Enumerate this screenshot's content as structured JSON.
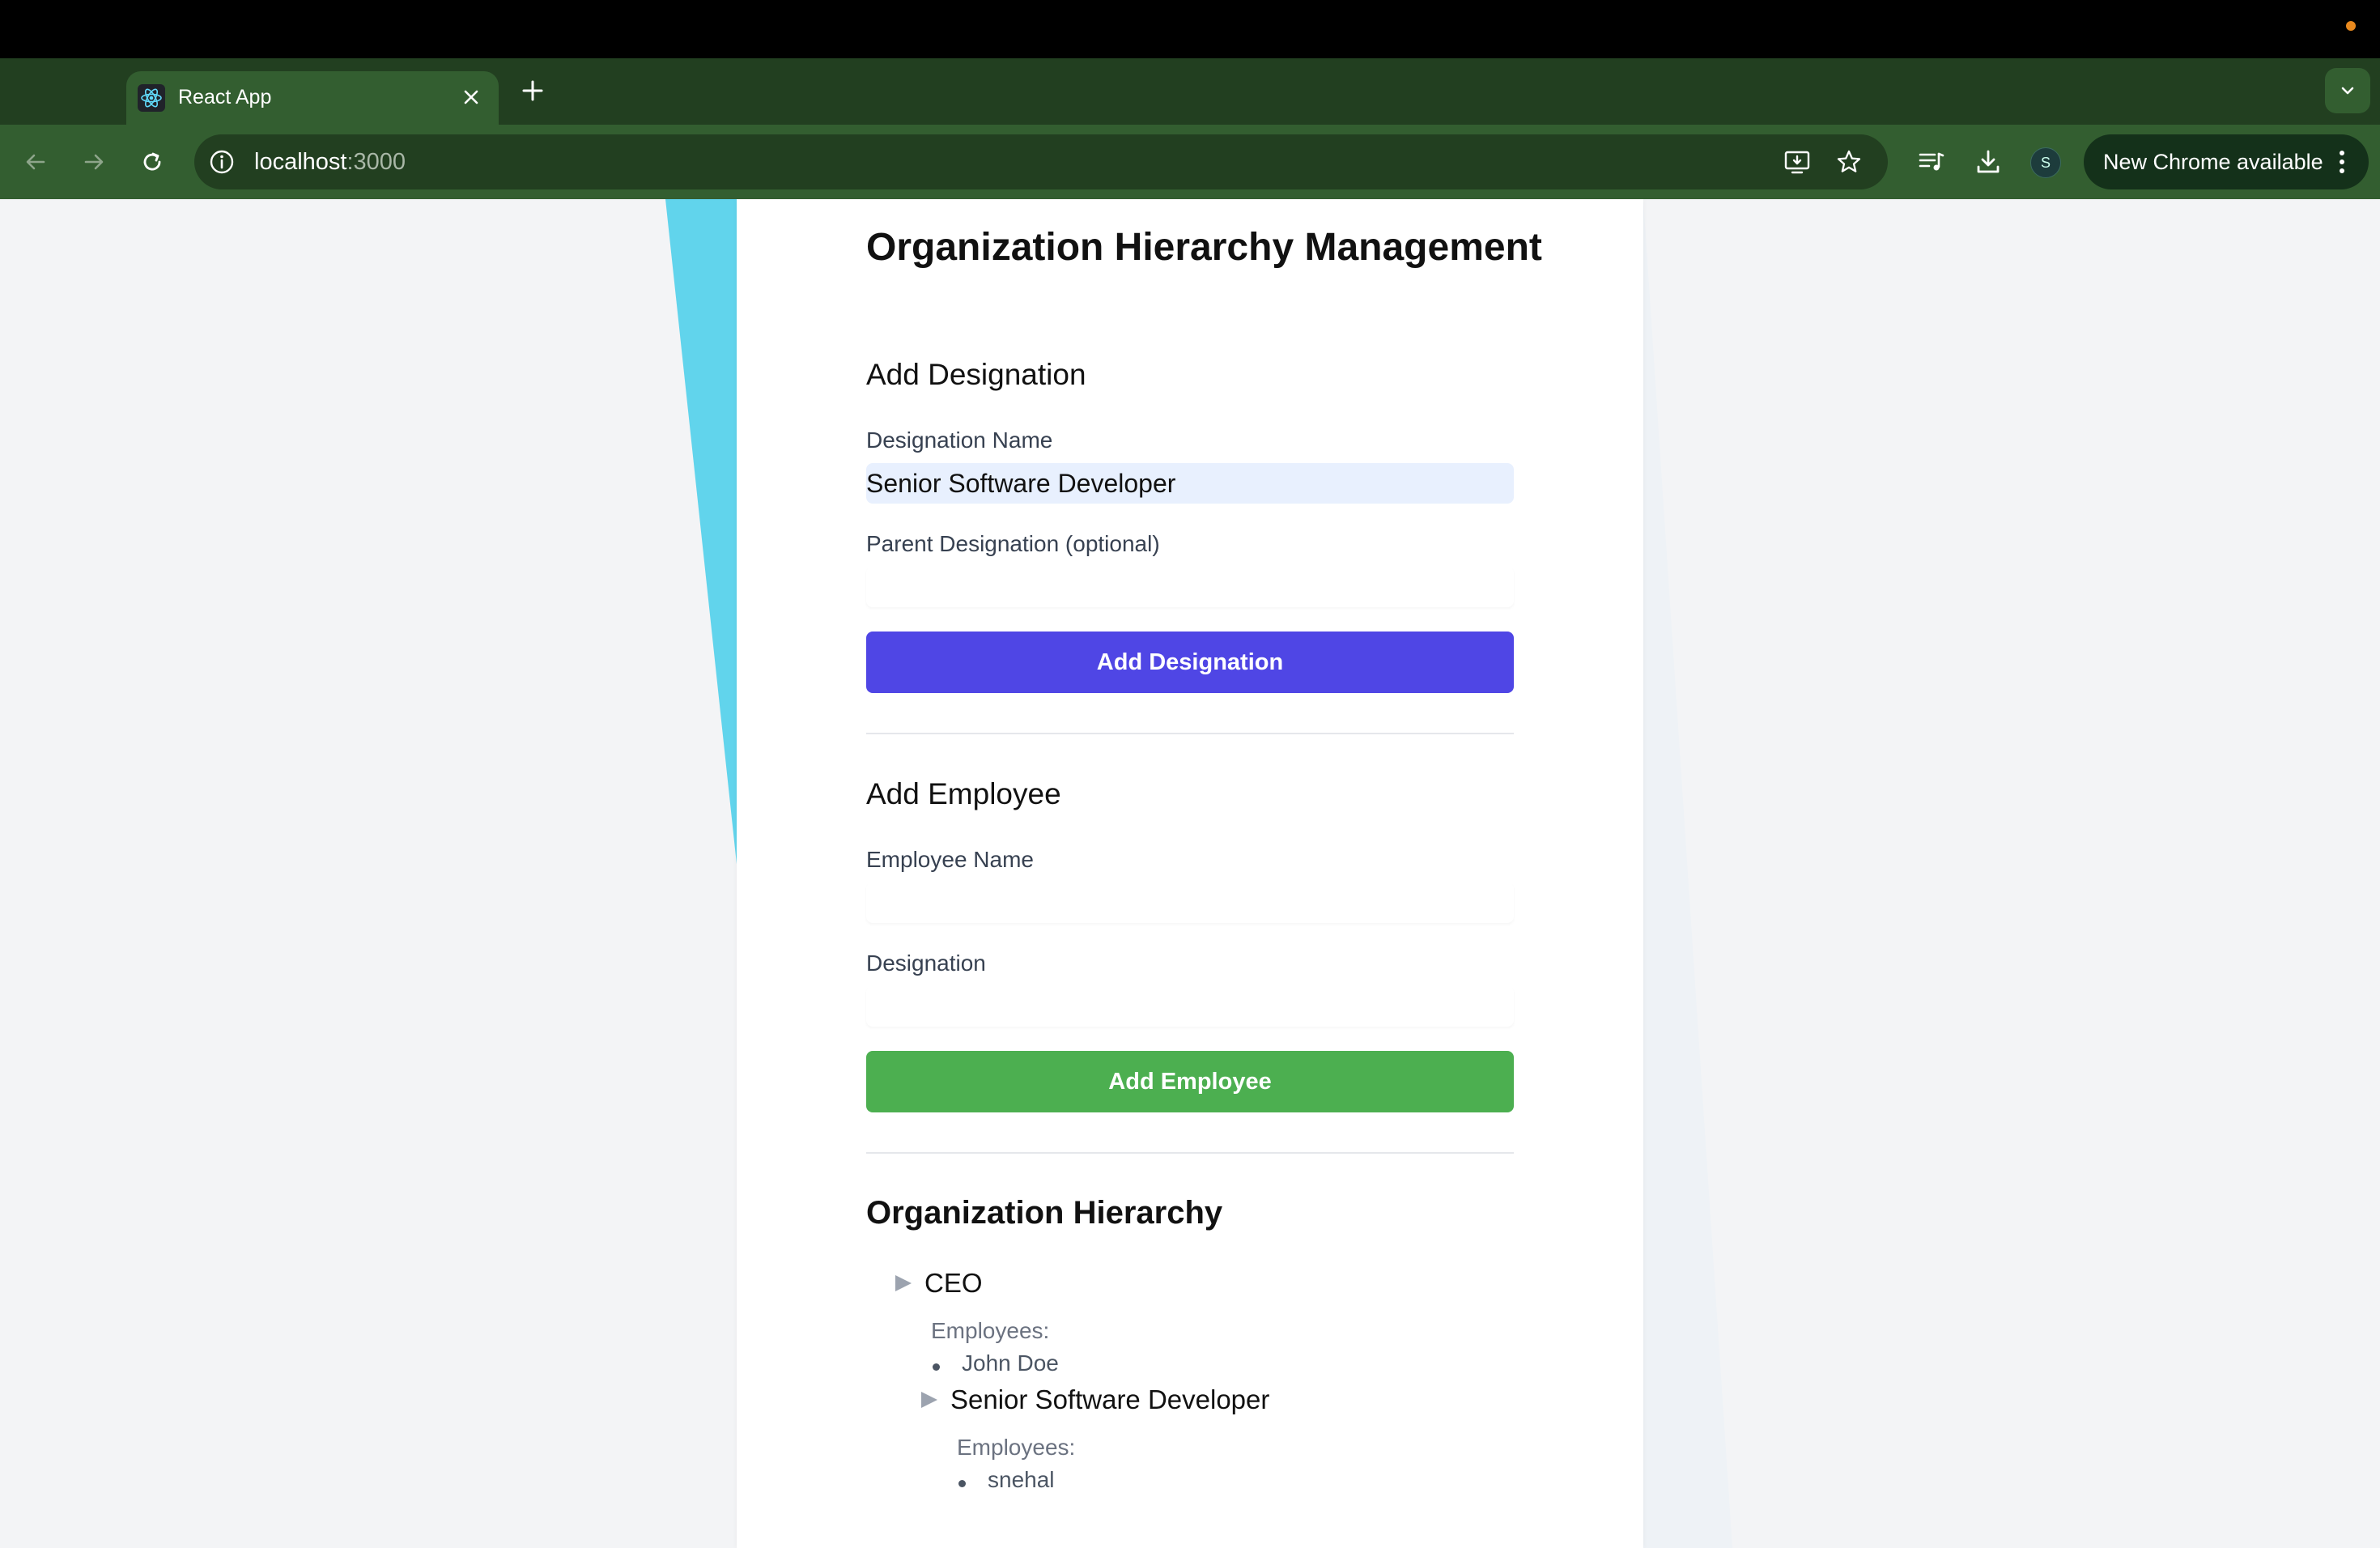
{
  "browser": {
    "tab_title": "React App",
    "new_tab_label": "+",
    "url_host": "localhost",
    "url_port": ":3000",
    "update_label": "New Chrome available",
    "profile_initial": "S"
  },
  "app": {
    "title": "Organization Hierarchy Management",
    "add_designation": {
      "heading": "Add Designation",
      "name_label": "Designation Name",
      "name_value": "Senior Software Developer",
      "parent_label": "Parent Designation (optional)",
      "parent_value": "",
      "button_label": "Add Designation"
    },
    "add_employee": {
      "heading": "Add Employee",
      "name_label": "Employee Name",
      "name_value": "",
      "designation_label": "Designation",
      "designation_value": "",
      "button_label": "Add Employee"
    },
    "hierarchy": {
      "heading": "Organization Hierarchy",
      "nodes": [
        {
          "name": "CEO",
          "employees_label": "Employees:",
          "employees": [
            "John Doe"
          ],
          "children": [
            {
              "name": "Senior Software Developer",
              "employees_label": "Employees:",
              "employees": [
                "snehal"
              ]
            }
          ]
        }
      ]
    }
  },
  "colors": {
    "primary_button": "#4f46e5",
    "success_button": "#4caf50",
    "browser_frame": "#335e30",
    "autofill_bg": "#e8f0fe",
    "accent_cyan": "#61d4ec"
  }
}
